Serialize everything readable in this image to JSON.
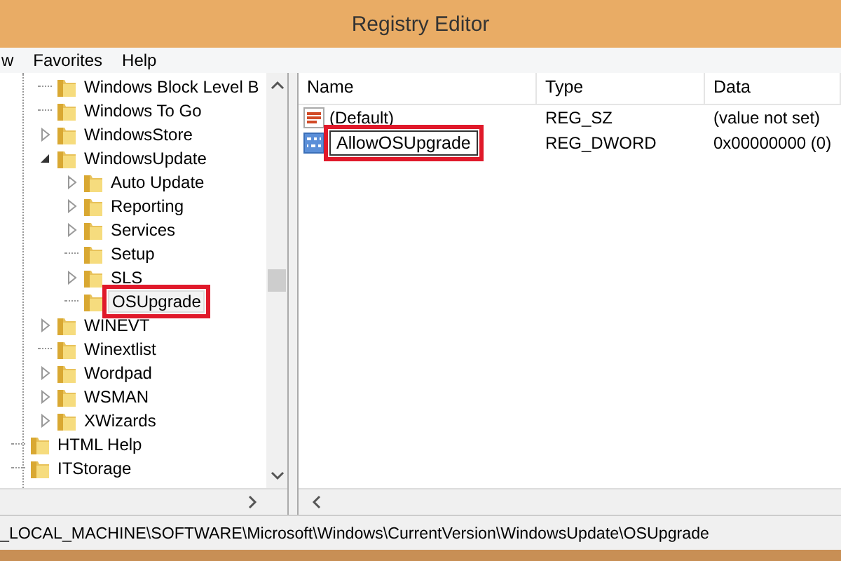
{
  "window": {
    "title": "Registry Editor"
  },
  "menu": [
    {
      "label": "w"
    },
    {
      "label": "Favorites"
    },
    {
      "label": "Help"
    }
  ],
  "tree": [
    {
      "children": [
        {
          "label": "Windows Block Level B",
          "selected": false,
          "highlighted": false
        },
        {
          "label": "Windows To Go",
          "selected": false,
          "highlighted": false
        },
        {
          "label": "WindowsStore",
          "expanded": false,
          "selected": false,
          "highlighted": false
        },
        {
          "label": "WindowsUpdate",
          "expanded": true,
          "selected": false,
          "highlighted": false,
          "children": [
            {
              "label": "Auto Update",
              "expanded": false,
              "selected": false,
              "highlighted": false
            },
            {
              "label": "Reporting",
              "expanded": false,
              "selected": false,
              "highlighted": false
            },
            {
              "label": "Services",
              "expanded": false,
              "selected": false,
              "highlighted": false
            },
            {
              "label": "Setup",
              "selected": false,
              "highlighted": false
            },
            {
              "label": "SLS",
              "expanded": false,
              "selected": false,
              "highlighted": false
            },
            {
              "label": "OSUpgrade",
              "selected": true,
              "highlighted": true
            }
          ]
        },
        {
          "label": "WINEVT",
          "expanded": false,
          "selected": false,
          "highlighted": false
        },
        {
          "label": "Winextlist",
          "selected": false,
          "highlighted": false
        },
        {
          "label": "Wordpad",
          "expanded": false,
          "selected": false,
          "highlighted": false
        },
        {
          "label": "WSMAN",
          "expanded": false,
          "selected": false,
          "highlighted": false
        },
        {
          "label": "XWizards",
          "expanded": false,
          "selected": false,
          "highlighted": false
        }
      ]
    },
    {
      "label": "HTML Help",
      "selected": false,
      "highlighted": false
    },
    {
      "label": "ITStorage",
      "selected": false,
      "highlighted": false
    }
  ],
  "table": {
    "columns": [
      "Name",
      "Type",
      "Data"
    ],
    "rows": [
      {
        "kind": "string",
        "name": "(Default)",
        "type": "REG_SZ",
        "data": "(value not set)",
        "editing": false,
        "highlighted": false
      },
      {
        "kind": "binary",
        "name": "AllowOSUpgrade",
        "type": "REG_DWORD",
        "data": "0x00000000 (0)",
        "editing": true,
        "highlighted": true
      }
    ]
  },
  "status_bar": "_LOCAL_MACHINE\\SOFTWARE\\Microsoft\\Windows\\CurrentVersion\\WindowsUpdate\\OSUpgrade"
}
